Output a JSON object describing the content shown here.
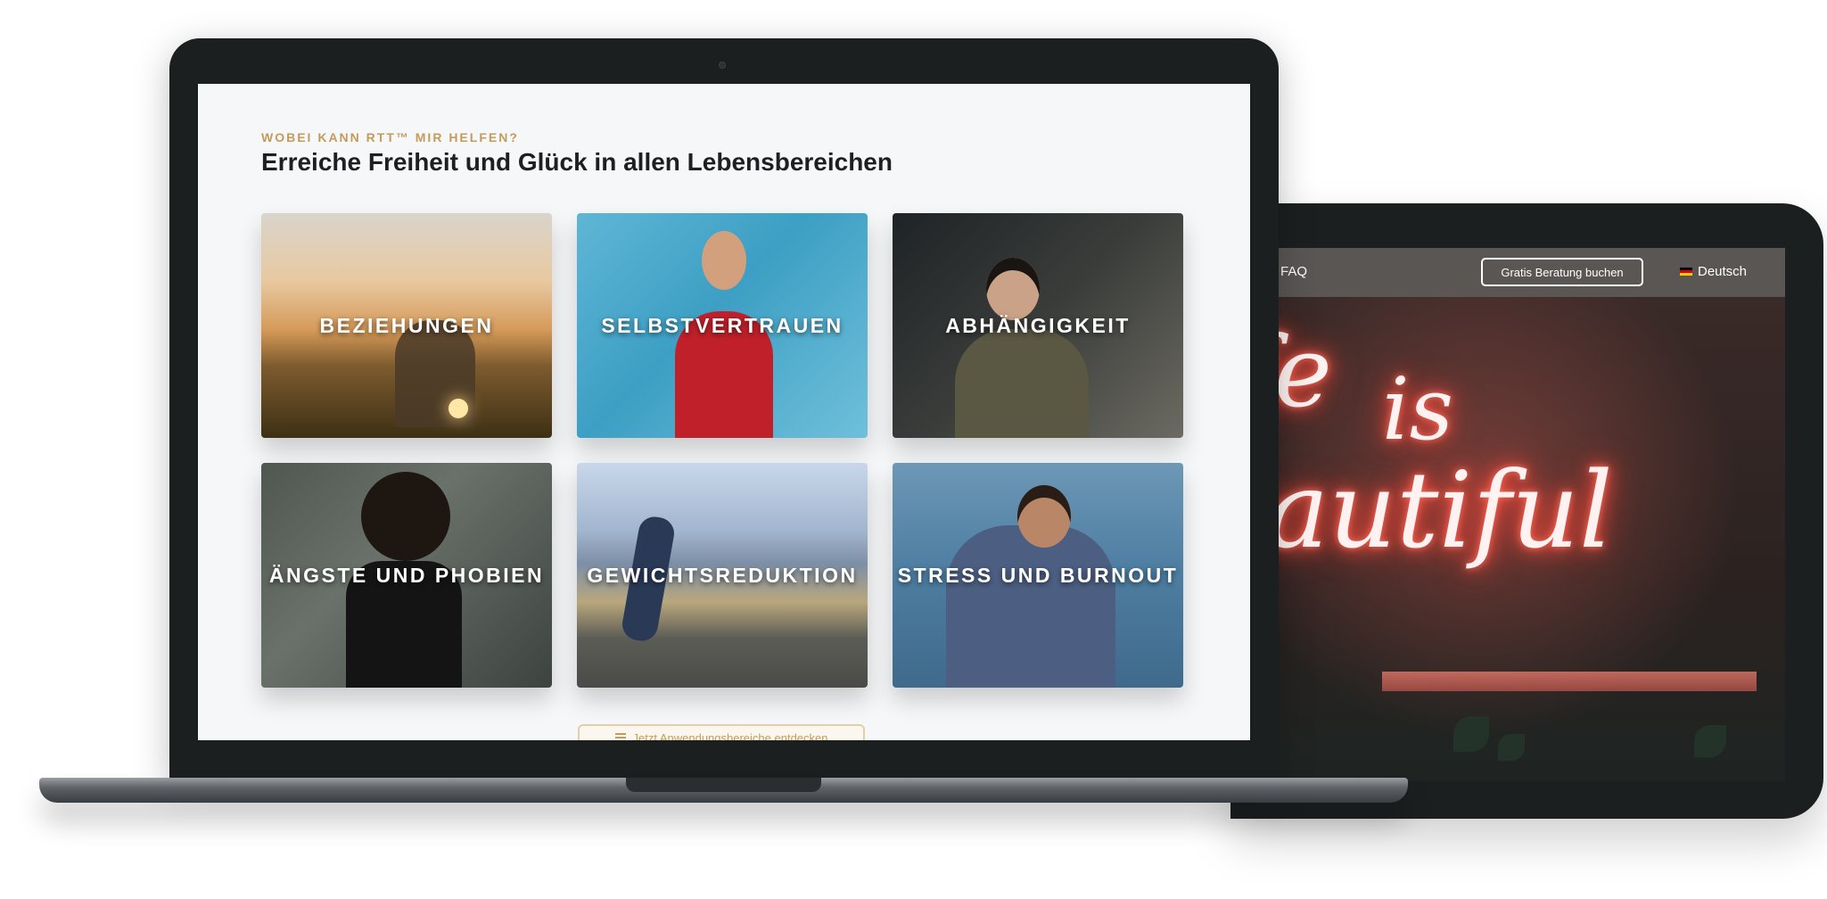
{
  "section": {
    "eyebrow": "WOBEI KANN RTT™ MIR HELFEN?",
    "headline": "Erreiche Freiheit und Glück in allen Lebensbereichen"
  },
  "cards": [
    {
      "label": "BEZIEHUNGEN"
    },
    {
      "label": "SELBSTVERTRAUEN"
    },
    {
      "label": "ABHÄNGIGKEIT"
    },
    {
      "label": "ÄNGSTE UND PHOBIEN"
    },
    {
      "label": "GEWICHTSREDUKTION"
    },
    {
      "label": "STRESS UND BURNOUT"
    }
  ],
  "discover_button": {
    "label": "Jetzt Anwendungsbereiche entdecken",
    "icon": "list-icon"
  },
  "tablet": {
    "nav": {
      "faq": "FAQ",
      "cta": "Gratis Beratung buchen",
      "language": "Deutsch",
      "language_icon": "german-flag-icon"
    },
    "hero": {
      "neon_line_1": "fe",
      "neon_line_2": "is",
      "neon_line_3": "eautiful"
    }
  },
  "colors": {
    "accent": "#c39c5a",
    "heading": "#1d1f22",
    "screen_bg": "#f6f7f9",
    "device": "#1c1f20"
  }
}
